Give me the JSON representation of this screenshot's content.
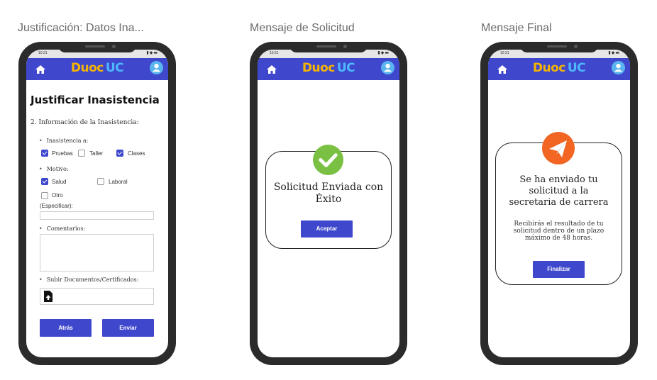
{
  "frames": [
    {
      "title": "Justificación: Datos Ina..."
    },
    {
      "title": "Mensaje de Solicitud"
    },
    {
      "title": "Mensaje Final"
    }
  ],
  "status": {
    "time": "10:21",
    "icons": "▮◆▬"
  },
  "header": {
    "logo_part1": "Duoc",
    "logo_part2": "UC"
  },
  "form": {
    "title": "Justificar Inasistencia",
    "section": "2. Información de la Inasistencia:",
    "inasistencia_label": "Inasistencia a:",
    "opt_pruebas": "Pruebas",
    "opt_taller": "Taller",
    "opt_clases": "Clases",
    "motivo_label": "Motivo:",
    "opt_salud": "Salud",
    "opt_laboral": "Laboral",
    "opt_otro": "Otro",
    "especificar_label": "(Especificar):",
    "comentarios_label": "Comentarios:",
    "subir_label": "Subir Documentos/Certificados:",
    "back_button": "Atrás",
    "send_button": "Enviar"
  },
  "success_dialog": {
    "line1": "Solicitud Enviada con",
    "line2": "Éxito",
    "accept_button": "Aceptar"
  },
  "final_dialog": {
    "line1": "Se ha enviado tu",
    "line2": "solicitud a la",
    "line3": "secretaria de carrera",
    "sub1": "Recibirás el resultado de tu",
    "sub2": "solicitud dentro de un plazo",
    "sub3": "máximo de 48 horas.",
    "finish_button": "Finalizar"
  },
  "colors": {
    "appbar": "#3f48cc",
    "logo_yellow": "#f5b400",
    "logo_blue": "#4db8ff",
    "success_green": "#7ac143",
    "send_orange": "#f26522"
  }
}
